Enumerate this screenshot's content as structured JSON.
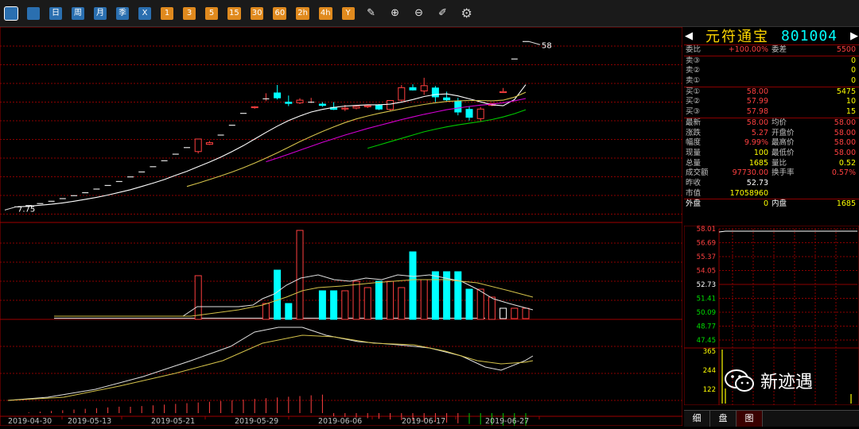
{
  "toolbar": {
    "buttons": [
      {
        "name": "candle-icon",
        "label": "",
        "color": "#2a6fb0"
      },
      {
        "name": "window-icon",
        "label": "",
        "color": "#2a6fb0"
      },
      {
        "name": "period-day",
        "label": "日",
        "color": "#2a6fb0"
      },
      {
        "name": "period-week",
        "label": "周",
        "color": "#2a6fb0"
      },
      {
        "name": "period-month",
        "label": "月",
        "color": "#2a6fb0"
      },
      {
        "name": "period-season",
        "label": "季",
        "color": "#2a6fb0"
      },
      {
        "name": "period-year",
        "label": "X",
        "color": "#2a6fb0"
      },
      {
        "name": "min-1",
        "label": "1",
        "color": "#e08a1e"
      },
      {
        "name": "min-3",
        "label": "3",
        "color": "#e08a1e"
      },
      {
        "name": "min-5",
        "label": "5",
        "color": "#e08a1e"
      },
      {
        "name": "min-15",
        "label": "15",
        "color": "#e08a1e"
      },
      {
        "name": "min-30",
        "label": "30",
        "color": "#e08a1e"
      },
      {
        "name": "min-60",
        "label": "60",
        "color": "#e08a1e"
      },
      {
        "name": "hour-2",
        "label": "2h",
        "color": "#e08a1e"
      },
      {
        "name": "hour-4",
        "label": "4h",
        "color": "#e08a1e"
      },
      {
        "name": "year-y",
        "label": "Y",
        "color": "#e08a1e"
      }
    ]
  },
  "stock": {
    "name": "元符通宝",
    "code": "801004"
  },
  "quote": {
    "weibi_label": "委比",
    "weibi_value": "+100.00%",
    "weicha_label": "委差",
    "weicha_value": "5500",
    "sell": [
      {
        "label": "卖⑤",
        "price": "",
        "vol": "0"
      },
      {
        "label": "卖④",
        "price": "",
        "vol": "0"
      },
      {
        "label": "卖③",
        "price": "",
        "vol": "0"
      },
      {
        "label": "卖②",
        "price": "",
        "vol": "0"
      },
      {
        "label": "卖①",
        "price": "",
        "vol": "0"
      }
    ],
    "buy": [
      {
        "label": "买①",
        "price": "58.00",
        "vol": "5475"
      },
      {
        "label": "买②",
        "price": "57.99",
        "vol": "10"
      },
      {
        "label": "买③",
        "price": "57.98",
        "vol": "15"
      }
    ],
    "stats": [
      {
        "l1": "最新",
        "v1": "58.00",
        "l2": "均价",
        "v2": "58.00"
      },
      {
        "l1": "涨跌",
        "v1": "5.27",
        "l2": "开盘价",
        "v2": "58.00"
      },
      {
        "l1": "幅度",
        "v1": "9.99%",
        "l2": "最高价",
        "v2": "58.00"
      },
      {
        "l1": "现量",
        "v1": "100",
        "l2": "最低价",
        "v2": "58.00"
      },
      {
        "l1": "总量",
        "v1": "1685",
        "l2": "量比",
        "v2": "0.52"
      },
      {
        "l1": "成交额",
        "v1": "97730.00",
        "l2": "换手率",
        "v2": "0.57%"
      },
      {
        "l1": "昨收",
        "v1": "52.73",
        "l2": "",
        "v2": ""
      },
      {
        "l1": "市值",
        "v1": "17058960",
        "l2": "",
        "v2": ""
      }
    ],
    "outer_label": "外盘",
    "outer_value": "0",
    "inner_label": "内盘",
    "inner_value": "1685"
  },
  "minute_chart": {
    "price_ticks": [
      "58.01",
      "56.69",
      "55.37",
      "54.05",
      "52.73",
      "51.41",
      "50.09",
      "48.77",
      "47.45"
    ],
    "vol_ticks": [
      "365",
      "244",
      "122"
    ]
  },
  "tabs": [
    "细",
    "盘",
    "图"
  ],
  "watermark": "新迹遇",
  "chart_data": {
    "type": "candlestick",
    "title": "",
    "price_labels": {
      "high": "58",
      "low": "7.75"
    },
    "dates": [
      "2019-04-30",
      "2019-05-13",
      "2019-05-21",
      "2019-05-29",
      "2019-06-06",
      "2019-06-17",
      "2019-06-27"
    ],
    "ohlc": [
      [
        7.8,
        7.8,
        7.8,
        7.8
      ],
      [
        8.2,
        8.2,
        8.2,
        8.2
      ],
      [
        8.8,
        8.8,
        8.8,
        8.8
      ],
      [
        9.5,
        9.5,
        9.5,
        9.5
      ],
      [
        10.3,
        10.3,
        10.3,
        10.3
      ],
      [
        11.2,
        11.2,
        11.2,
        11.2
      ],
      [
        12.1,
        12.1,
        12.1,
        12.1
      ],
      [
        13.2,
        13.2,
        13.2,
        13.2
      ],
      [
        14.3,
        14.3,
        14.3,
        14.3
      ],
      [
        15.5,
        15.5,
        15.5,
        15.5
      ],
      [
        16.9,
        16.9,
        16.9,
        16.9
      ],
      [
        18.4,
        18.4,
        18.4,
        18.4
      ],
      [
        20.0,
        20.0,
        20.0,
        20.0
      ],
      [
        21.8,
        21.8,
        21.8,
        21.8
      ],
      [
        23.8,
        23.8,
        23.8,
        23.8
      ],
      [
        25.8,
        25.8,
        25.8,
        25.8
      ],
      [
        24.6,
        28.4,
        24.0,
        28.4
      ],
      [
        26.8,
        27.8,
        26.6,
        27.3
      ],
      [
        29.6,
        29.6,
        29.6,
        29.6
      ],
      [
        32.6,
        32.6,
        32.6,
        32.6
      ],
      [
        36.2,
        36.2,
        36.2,
        36.2
      ],
      [
        38.0,
        38.4,
        37.6,
        38.2
      ],
      [
        40.6,
        42.3,
        39.9,
        40.6
      ],
      [
        42.4,
        44.8,
        40.4,
        40.9
      ],
      [
        39.6,
        41.6,
        38.4,
        39.2
      ],
      [
        39.4,
        40.8,
        39.0,
        40.2
      ],
      [
        39.6,
        40.9,
        39.3,
        39.6
      ],
      [
        39.0,
        39.6,
        38.2,
        38.6
      ],
      [
        38.0,
        39.6,
        37.2,
        37.4
      ],
      [
        37.6,
        38.8,
        36.9,
        37.8
      ],
      [
        37.8,
        38.6,
        37.4,
        38.3
      ],
      [
        38.2,
        38.8,
        37.8,
        38.5
      ],
      [
        38.6,
        39.0,
        37.2,
        37.5
      ],
      [
        37.4,
        40.2,
        37.0,
        40.1
      ],
      [
        40.2,
        44.8,
        39.8,
        44.0
      ],
      [
        44.0,
        45.0,
        43.1,
        43.3
      ],
      [
        43.0,
        47.0,
        41.8,
        44.6
      ],
      [
        43.9,
        44.5,
        39.6,
        41.2
      ],
      [
        40.9,
        42.8,
        39.9,
        40.3
      ],
      [
        39.9,
        40.9,
        35.6,
        36.6
      ],
      [
        37.4,
        38.4,
        34.0,
        35.0
      ],
      [
        34.6,
        38.1,
        33.6,
        37.5
      ],
      [
        38.6,
        39.3,
        38.4,
        39.2
      ],
      [
        42.5,
        43.9,
        42.5,
        42.8
      ],
      [
        52.7,
        52.7,
        52.7,
        52.7
      ],
      [
        58.0,
        58.0,
        58.0,
        58.0
      ]
    ],
    "ma": [
      {
        "name": "",
        "color": "#ffffff",
        "values": [
          7.8,
          8.0,
          8.3,
          8.6,
          9.0,
          9.5,
          10.1,
          10.7,
          11.4,
          12.2,
          13.0,
          14.0,
          15.0,
          16.1,
          17.4,
          18.6,
          20.0,
          21.4,
          22.9,
          24.6,
          26.4,
          28.4,
          30.4,
          32.3,
          34.0,
          35.4,
          36.6,
          37.4,
          38.0,
          38.4,
          38.6,
          38.8,
          38.8,
          39.0,
          39.6,
          40.4,
          41.3,
          41.9,
          42.1,
          41.5,
          40.6,
          39.7,
          38.8,
          38.5,
          40.4,
          44.9
        ]
      },
      {
        "name": "",
        "color": "#d4c24a",
        "values": [
          null,
          null,
          null,
          null,
          null,
          null,
          null,
          null,
          null,
          null,
          null,
          null,
          null,
          null,
          null,
          14.0,
          15.0,
          16.1,
          17.2,
          18.4,
          19.7,
          21.1,
          22.6,
          24.2,
          25.9,
          27.6,
          29.2,
          30.7,
          32.1,
          33.4,
          34.5,
          35.4,
          36.2,
          36.9,
          37.6,
          38.3,
          38.9,
          39.4,
          39.8,
          40.0,
          40.1,
          40.1,
          40.0,
          40.2,
          41.1,
          42.6
        ]
      },
      {
        "name": "",
        "color": "#d400d4",
        "values": [
          null,
          null,
          null,
          null,
          null,
          null,
          null,
          null,
          null,
          null,
          null,
          null,
          null,
          null,
          null,
          null,
          null,
          null,
          null,
          null,
          null,
          null,
          21.5,
          22.6,
          23.8,
          25.0,
          26.2,
          27.4,
          28.5,
          29.6,
          30.6,
          31.6,
          32.5,
          33.4,
          34.3,
          35.1,
          35.9,
          36.6,
          37.3,
          37.8,
          38.3,
          38.7,
          39.0,
          39.4,
          40.0,
          40.7
        ]
      },
      {
        "name": "",
        "color": "#00c800",
        "values": [
          null,
          null,
          null,
          null,
          null,
          null,
          null,
          null,
          null,
          null,
          null,
          null,
          null,
          null,
          null,
          null,
          null,
          null,
          null,
          null,
          null,
          null,
          null,
          null,
          null,
          null,
          null,
          null,
          null,
          null,
          null,
          25.6,
          26.6,
          27.6,
          28.6,
          29.6,
          30.6,
          31.4,
          32.1,
          32.7,
          33.2,
          33.7,
          34.3,
          35.1,
          36.1,
          37.3
        ]
      }
    ],
    "volume": [
      0,
      0,
      0,
      0,
      0,
      0,
      0,
      0,
      0,
      0,
      0,
      0,
      0,
      0,
      0,
      0,
      0,
      0,
      0,
      0,
      0,
      0,
      0,
      0,
      0,
      0,
      0,
      0,
      0,
      0,
      0,
      0,
      0,
      0,
      0,
      0,
      0,
      0,
      0,
      0,
      0,
      0,
      0,
      0,
      0,
      0
    ],
    "ylim": [
      5,
      60
    ]
  }
}
